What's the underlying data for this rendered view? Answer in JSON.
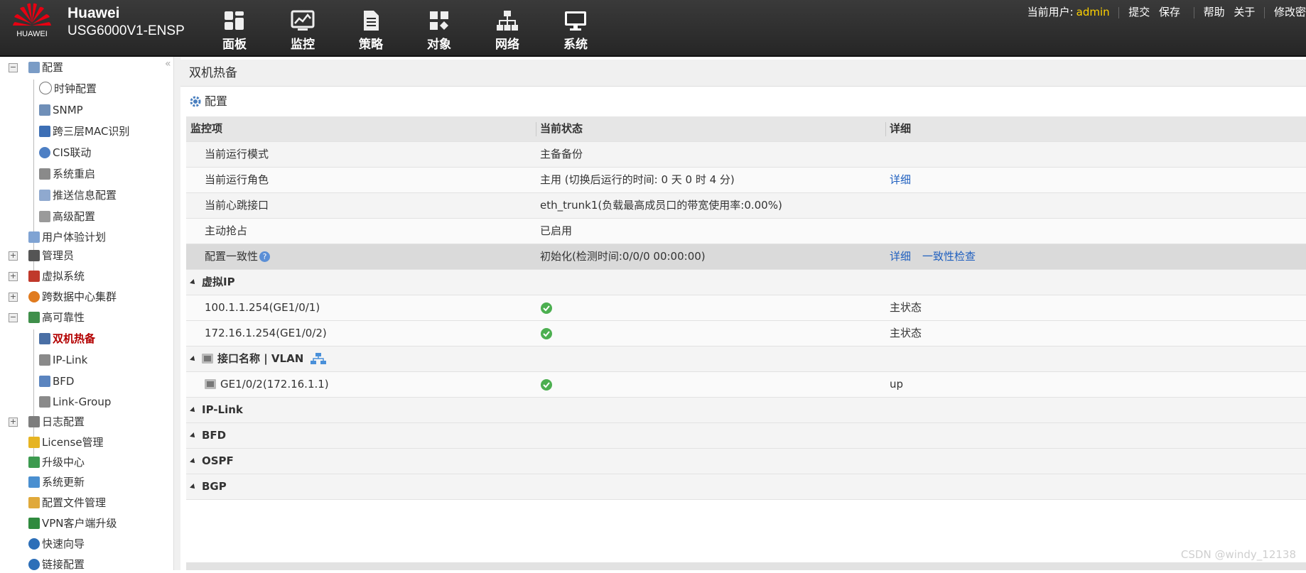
{
  "header": {
    "logo_text": "HUAWEI",
    "brand_name": "Huawei",
    "device_model": "USG6000V1-ENSP",
    "nav": [
      {
        "label": "面板",
        "icon": "dashboard-icon"
      },
      {
        "label": "监控",
        "icon": "monitor-icon"
      },
      {
        "label": "策略",
        "icon": "policy-icon"
      },
      {
        "label": "对象",
        "icon": "object-icon"
      },
      {
        "label": "网络",
        "icon": "network-icon"
      },
      {
        "label": "系统",
        "icon": "system-icon"
      }
    ],
    "user_label": "当前用户:",
    "user_name": "admin",
    "actions": {
      "submit": "提交",
      "save": "保存",
      "help": "帮助",
      "about": "关于",
      "change_password": "修改密"
    }
  },
  "sidebar": {
    "config": "配置",
    "clock": "时钟配置",
    "snmp": "SNMP",
    "mac": "跨三层MAC识别",
    "cis": "CIS联动",
    "reboot": "系统重启",
    "push": "推送信息配置",
    "advanced": "高级配置",
    "ux": "用户体验计划",
    "admin": "管理员",
    "vsys": "虚拟系统",
    "dc_cluster": "跨数据中心集群",
    "ha": "高可靠性",
    "hrp": "双机热备",
    "iplink": "IP-Link",
    "bfd": "BFD",
    "linkgroup": "Link-Group",
    "log": "日志配置",
    "license": "License管理",
    "upgrade": "升级中心",
    "update": "系统更新",
    "cfgfile": "配置文件管理",
    "vpn": "VPN客户端升级",
    "wizard": "快速向导",
    "link": "链接配置"
  },
  "main": {
    "title": "双机热备",
    "config_label": "配置",
    "columns": {
      "item": "监控项",
      "status": "当前状态",
      "detail": "详细"
    },
    "rows": {
      "mode": {
        "label": "当前运行模式",
        "status": "主备备份"
      },
      "role": {
        "label": "当前运行角色",
        "status": "主用 (切换后运行的时间: 0 天 0 时 4 分)",
        "detail": "详细"
      },
      "heartbeat": {
        "label": "当前心跳接口",
        "status": "eth_trunk1(负载最高成员口的带宽使用率:0.00%)"
      },
      "preempt": {
        "label": "主动抢占",
        "status": "已启用"
      },
      "consistency": {
        "label": "配置一致性",
        "status": "初始化(检测时间:0/0/0 00:00:00)",
        "detail": "详细",
        "check": "一致性检查"
      }
    },
    "sections": {
      "vip": "虚拟IP",
      "iface": "接口名称 | VLAN",
      "iplink": "IP-Link",
      "bfd": "BFD",
      "ospf": "OSPF",
      "bgp": "BGP"
    },
    "vip_rows": [
      {
        "label": "100.1.1.254(GE1/0/1)",
        "detail": "主状态"
      },
      {
        "label": "172.16.1.254(GE1/0/2)",
        "detail": "主状态"
      }
    ],
    "iface_rows": [
      {
        "label": "GE1/0/2(172.16.1.1)",
        "detail": "up"
      }
    ]
  },
  "watermark": "CSDN @windy_12138",
  "colors": {
    "header_bg": "#2e2e2e",
    "user_name": "#ffd200",
    "active_item": "#b30000",
    "link": "#1f5fbf",
    "ok": "#4caf50"
  }
}
